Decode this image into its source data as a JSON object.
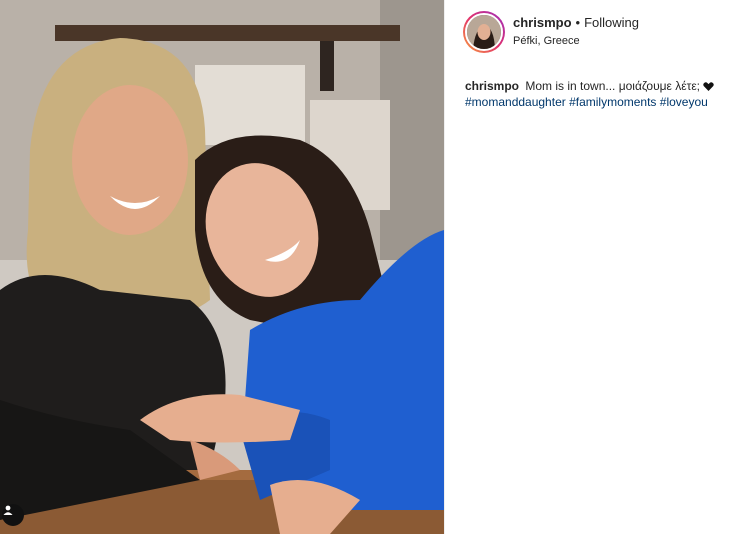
{
  "post": {
    "username": "chrismpo",
    "separator": "•",
    "follow_state": "Following",
    "location": "Péfki, Greece",
    "avatar_icon": "profile-avatar",
    "caption": {
      "username": "chrismpo",
      "text_before": "Mom is in town... μοιάζουμε λέτε;",
      "emoji_icon": "black-heart-icon",
      "hashtags": [
        "#momanddaughter",
        "#familymoments",
        "#loveyou"
      ]
    },
    "photo_icon": "post-photo",
    "tag_icon": "user-tag-icon"
  },
  "colors": {
    "hashtag": "#00376b",
    "text": "#262626",
    "sweater": "#1f5fd0"
  }
}
